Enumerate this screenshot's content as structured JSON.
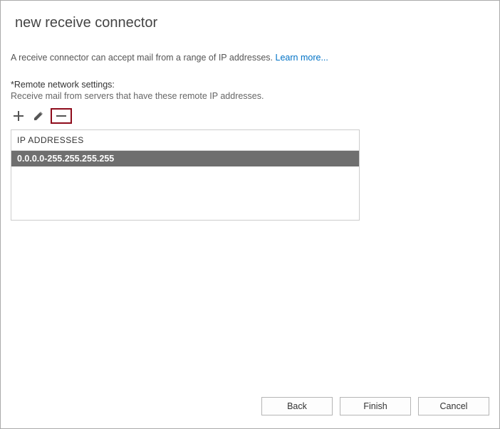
{
  "title": "new receive connector",
  "description": "A receive connector can accept mail from a range of IP addresses.",
  "learn_more": "Learn more...",
  "section": {
    "label": "*Remote network settings:",
    "sublabel": "Receive mail from servers that have these remote IP addresses."
  },
  "toolbar": {
    "add_label": "Add",
    "edit_label": "Edit",
    "remove_label": "Remove"
  },
  "table": {
    "header": "IP ADDRESSES",
    "rows": [
      {
        "value": "0.0.0.0-255.255.255.255",
        "selected": true
      }
    ]
  },
  "footer": {
    "back": "Back",
    "finish": "Finish",
    "cancel": "Cancel"
  }
}
